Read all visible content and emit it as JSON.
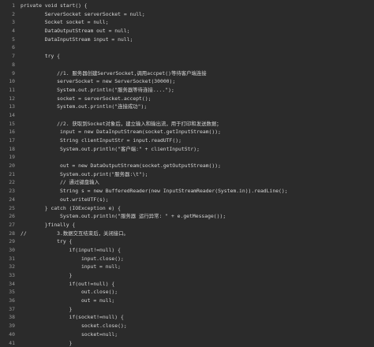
{
  "editor": {
    "lines": [
      {
        "n": "1",
        "text": "private void start() {"
      },
      {
        "n": "2",
        "text": "        ServerSocket serverSocket = null;"
      },
      {
        "n": "3",
        "text": "        Socket socket = null;"
      },
      {
        "n": "4",
        "text": "        DataOutputStream out = null;"
      },
      {
        "n": "5",
        "text": "        DataInputStream input = null;"
      },
      {
        "n": "6",
        "text": ""
      },
      {
        "n": "7",
        "text": "        try {"
      },
      {
        "n": "8",
        "text": ""
      },
      {
        "n": "9",
        "text": "            //1. 服务器创建ServerSocket,调用accpet()等待客户端连接"
      },
      {
        "n": "10",
        "text": "            serverSocket = new ServerSocket(30000);"
      },
      {
        "n": "11",
        "text": "            System.out.println(\"服务器等待连接....\");"
      },
      {
        "n": "12",
        "text": "            socket = serverSocket.accept();"
      },
      {
        "n": "13",
        "text": "            System.out.println(\"连接成功\");"
      },
      {
        "n": "14",
        "text": ""
      },
      {
        "n": "15",
        "text": "            //2. 获取到Socket对象后，建立输入和输出流，用于打印和发送数据；"
      },
      {
        "n": "16",
        "text": "             input = new DataInputStream(socket.getInputStream());"
      },
      {
        "n": "17",
        "text": "             String clientInputStr = input.readUTF();"
      },
      {
        "n": "18",
        "text": "             System.out.println(\"客户端:\" + clientInputStr);"
      },
      {
        "n": "19",
        "text": ""
      },
      {
        "n": "20",
        "text": "             out = new DataOutputStream(socket.getOutputStream());"
      },
      {
        "n": "21",
        "text": "             System.out.print(\"服务器:\\t\");"
      },
      {
        "n": "22",
        "text": "             // 通过键盘输入"
      },
      {
        "n": "23",
        "text": "             String s = new BufferedReader(new InputStreamReader(System.in)).readLine();"
      },
      {
        "n": "24",
        "text": "             out.writeUTF(s);"
      },
      {
        "n": "25",
        "text": "        } catch (IOException e) {"
      },
      {
        "n": "26",
        "text": "             System.out.println(\"服务器 运行异常: \" + e.getMessage());"
      },
      {
        "n": "27",
        "text": "        }finally {"
      },
      {
        "n": "28",
        "text": "//          3.数据交互结束后，关闭接口。"
      },
      {
        "n": "29",
        "text": "            try {"
      },
      {
        "n": "30",
        "text": "                if(input!=null) {"
      },
      {
        "n": "31",
        "text": "                    input.close();"
      },
      {
        "n": "32",
        "text": "                    input = null;"
      },
      {
        "n": "33",
        "text": "                }"
      },
      {
        "n": "34",
        "text": "                if(out!=null) {"
      },
      {
        "n": "35",
        "text": "                    out.close();"
      },
      {
        "n": "36",
        "text": "                    out = null;"
      },
      {
        "n": "37",
        "text": "                }"
      },
      {
        "n": "38",
        "text": "                if(socket!=null) {"
      },
      {
        "n": "39",
        "text": "                    socket.close();"
      },
      {
        "n": "40",
        "text": "                    socket=null;"
      },
      {
        "n": "41",
        "text": "                }"
      }
    ]
  }
}
